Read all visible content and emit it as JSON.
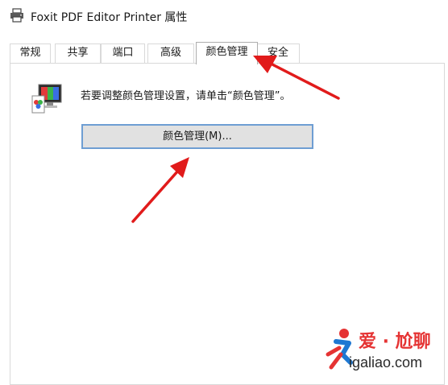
{
  "window": {
    "title": "Foxit PDF Editor Printer 属性",
    "icon": "printer-icon"
  },
  "tabs": [
    {
      "label": "常规",
      "active": false
    },
    {
      "label": "共享",
      "active": false
    },
    {
      "label": "端口",
      "active": false
    },
    {
      "label": "高级",
      "active": false
    },
    {
      "label": "颜色管理",
      "active": true
    },
    {
      "label": "安全",
      "active": false
    }
  ],
  "panel": {
    "icon": "color-management-icon",
    "info_text": "若要调整颜色管理设置，请单击“颜色管理”。",
    "button_label": "颜色管理(M)..."
  },
  "annotations": {
    "arrow_color": "#e11b1b"
  },
  "watermark": {
    "title": "爱 · 尬聊",
    "url": "igaliao.com",
    "accent": "#e53333",
    "secondary": "#1e78d2"
  }
}
